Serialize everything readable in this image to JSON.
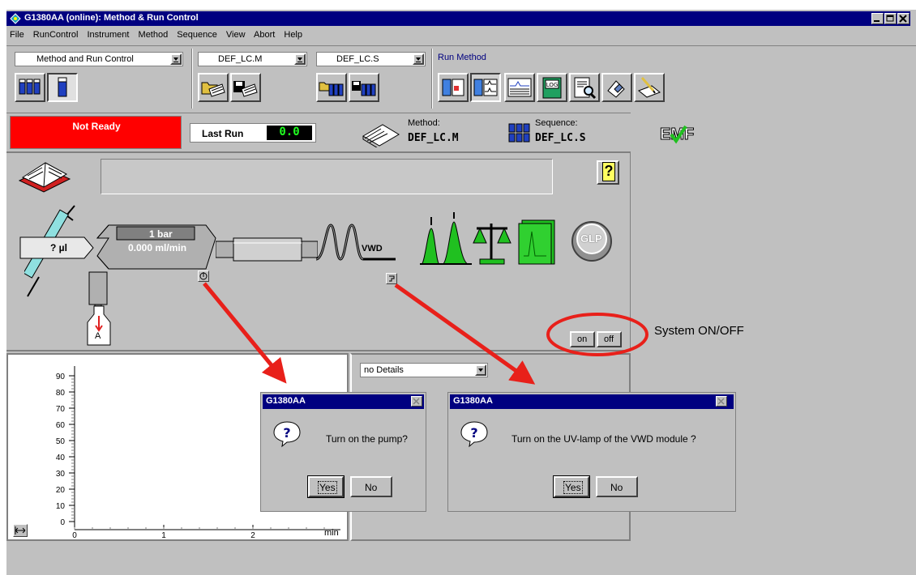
{
  "window": {
    "title": "G1380AA (online): Method & Run Control"
  },
  "menu": [
    {
      "label": "File"
    },
    {
      "label": "RunControl"
    },
    {
      "label": "Instrument"
    },
    {
      "label": "Method"
    },
    {
      "label": "Sequence"
    },
    {
      "label": "View"
    },
    {
      "label": "Abort"
    },
    {
      "label": "Help"
    }
  ],
  "toolbar": {
    "view_select": "Method and Run Control",
    "method_select": "DEF_LC.M",
    "sequence_select": "DEF_LC.S",
    "group_label": "Run Method",
    "log_icon_text": "LOG"
  },
  "status": {
    "state": "Not Ready",
    "last_run_label": "Last Run",
    "last_run_value": "0.0",
    "method_label": "Method:",
    "method_value": "DEF_LC.M",
    "sequence_label": "Sequence:",
    "sequence_value": "DEF_LC.S",
    "emf_text": "EMF"
  },
  "diagram": {
    "help_icon": "?",
    "injector_volume": "? µl",
    "pump_pressure": "1 bar",
    "pump_flow": "0.000 ml/min",
    "detector_label": "VWD",
    "solvent_label": "A",
    "glp_label": "GLP",
    "on_label": "on",
    "off_label": "off"
  },
  "annotation": {
    "system_onoff": "System ON/OFF"
  },
  "plot": {
    "y_ticks": [
      "90",
      "80",
      "70",
      "60",
      "50",
      "40",
      "30",
      "20",
      "10",
      "0"
    ],
    "x_ticks": [
      "0",
      "1",
      "2"
    ],
    "x_unit": "min"
  },
  "details": {
    "select": "no Details"
  },
  "dialog_pump": {
    "title": "G1380AA",
    "message": "Turn on the pump?",
    "yes": "Yes",
    "no": "No"
  },
  "dialog_lamp": {
    "title": "G1380AA",
    "message": "Turn on the UV-lamp of the VWD module ?",
    "yes": "Yes",
    "no": "No"
  },
  "colors": {
    "titlebar": "#000080",
    "not_ready": "#ff0000",
    "panel": "#c0c0c0",
    "arrow": "#e8201a",
    "green": "#22cc22"
  }
}
